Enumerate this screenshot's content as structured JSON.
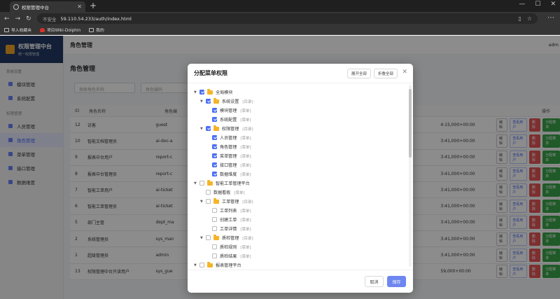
{
  "browser": {
    "tab_title": "权限管理中台",
    "insecure_label": "不安全",
    "url": "59.110.54.233/auth/index.html",
    "bookmarks": [
      "导入收藏夹",
      "项目Wiki-Dolphin",
      "我的"
    ]
  },
  "app": {
    "brand_title": "权限管理中台",
    "brand_subtitle": "统一权限管理",
    "nav_section_system": "系统设置",
    "nav_section_permission": "权限管理",
    "nav_items": [
      {
        "label": "模块管理",
        "active": false
      },
      {
        "label": "系统配置",
        "active": false
      },
      {
        "label": "人员管理",
        "active": false
      },
      {
        "label": "角色管理",
        "active": true
      },
      {
        "label": "菜单管理",
        "active": false
      },
      {
        "label": "接口管理",
        "active": false
      },
      {
        "label": "数据维度",
        "active": false
      }
    ],
    "topbar_title": "角色管理",
    "user_label": "adm",
    "page_title": "角色管理",
    "filter_name_placeholder": "搜索角色名称",
    "filter_code_placeholder": "角色编码",
    "columns": {
      "id": "ID",
      "name": "角色名称",
      "code": "角色编",
      "ops": "操作"
    },
    "op_labels": {
      "edit": "编辑",
      "view": "查看用户",
      "delete": "删除",
      "assign": "分配菜单"
    },
    "rows": [
      {
        "id": "12",
        "name": "访客",
        "code": "guest",
        "time": "4:15,000+00:00"
      },
      {
        "id": "10",
        "name": "智能文档管理员",
        "code": "ai-doc-a",
        "time": "3:41,000+00:00"
      },
      {
        "id": "9",
        "name": "报表中台用户",
        "code": "report-c",
        "time": "3:41,000+00:00"
      },
      {
        "id": "8",
        "name": "报表中台管理员",
        "code": "report-c",
        "time": "3:41,000+00:00"
      },
      {
        "id": "7",
        "name": "智能工单用户",
        "code": "ai-ticket",
        "time": "3:41,000+00:00"
      },
      {
        "id": "6",
        "name": "智能工单管理员",
        "code": "ai-ticket",
        "time": "3:41,000+00:00"
      },
      {
        "id": "5",
        "name": "部门主管",
        "code": "dept_ma",
        "time": "3:41,000+00:00"
      },
      {
        "id": "2",
        "name": "系统管理员",
        "code": "sys_man",
        "time": "3:41,000+00:00"
      },
      {
        "id": "1",
        "name": "超级管理员",
        "code": "admin",
        "time": "3:41,000+00:00"
      },
      {
        "id": "13",
        "name": "权限管理中台只读用户",
        "code": "sys_gue",
        "time": "59,000+00:00"
      }
    ]
  },
  "modal": {
    "title": "分配菜单权限",
    "expand_all": "展开全部",
    "collapse_all": "折叠全部",
    "cancel": "取消",
    "save": "保存",
    "tree": [
      {
        "label": "全局模块",
        "level": 0,
        "arrow": true,
        "checked": true,
        "folder": true,
        "tag": ""
      },
      {
        "label": "系统设置",
        "level": 1,
        "arrow": true,
        "checked": true,
        "folder": true,
        "tag": "[目录]"
      },
      {
        "label": "模块管理",
        "level": 2,
        "arrow": false,
        "checked": true,
        "folder": false,
        "tag": "[菜单]"
      },
      {
        "label": "系统配置",
        "level": 2,
        "arrow": false,
        "checked": true,
        "folder": false,
        "tag": "[菜单]"
      },
      {
        "label": "权限管理",
        "level": 1,
        "arrow": true,
        "checked": true,
        "folder": true,
        "tag": "[目录]"
      },
      {
        "label": "人员管理",
        "level": 2,
        "arrow": false,
        "checked": true,
        "folder": false,
        "tag": "[菜单]"
      },
      {
        "label": "角色管理",
        "level": 2,
        "arrow": false,
        "checked": true,
        "folder": false,
        "tag": "[菜单]"
      },
      {
        "label": "菜单管理",
        "level": 2,
        "arrow": false,
        "checked": true,
        "folder": false,
        "tag": "[菜单]"
      },
      {
        "label": "接口管理",
        "level": 2,
        "arrow": false,
        "checked": true,
        "folder": false,
        "tag": "[菜单]"
      },
      {
        "label": "数据维度",
        "level": 2,
        "arrow": false,
        "checked": true,
        "folder": false,
        "tag": "[菜单]"
      },
      {
        "label": "智能工单管理平台",
        "level": 0,
        "arrow": true,
        "checked": false,
        "folder": true,
        "tag": ""
      },
      {
        "label": "数据看板",
        "level": 1,
        "arrow": false,
        "checked": false,
        "folder": false,
        "tag": "[菜单]"
      },
      {
        "label": "工单管理",
        "level": 1,
        "arrow": true,
        "checked": false,
        "folder": true,
        "tag": "[目录]"
      },
      {
        "label": "工单列表",
        "level": 2,
        "arrow": false,
        "checked": false,
        "folder": false,
        "tag": "[菜单]"
      },
      {
        "label": "创建工单",
        "level": 2,
        "arrow": false,
        "checked": false,
        "folder": false,
        "tag": "[菜单]"
      },
      {
        "label": "工单详情",
        "level": 2,
        "arrow": false,
        "checked": false,
        "folder": false,
        "tag": "[菜单]"
      },
      {
        "label": "质检管理",
        "level": 1,
        "arrow": true,
        "checked": false,
        "folder": true,
        "tag": "[目录]"
      },
      {
        "label": "质检规则",
        "level": 2,
        "arrow": false,
        "checked": false,
        "folder": false,
        "tag": "[菜单]"
      },
      {
        "label": "质检结果",
        "level": 2,
        "arrow": false,
        "checked": false,
        "folder": false,
        "tag": "[菜单]"
      },
      {
        "label": "报表管理平台",
        "level": 0,
        "arrow": true,
        "checked": false,
        "folder": true,
        "tag": ""
      }
    ]
  }
}
